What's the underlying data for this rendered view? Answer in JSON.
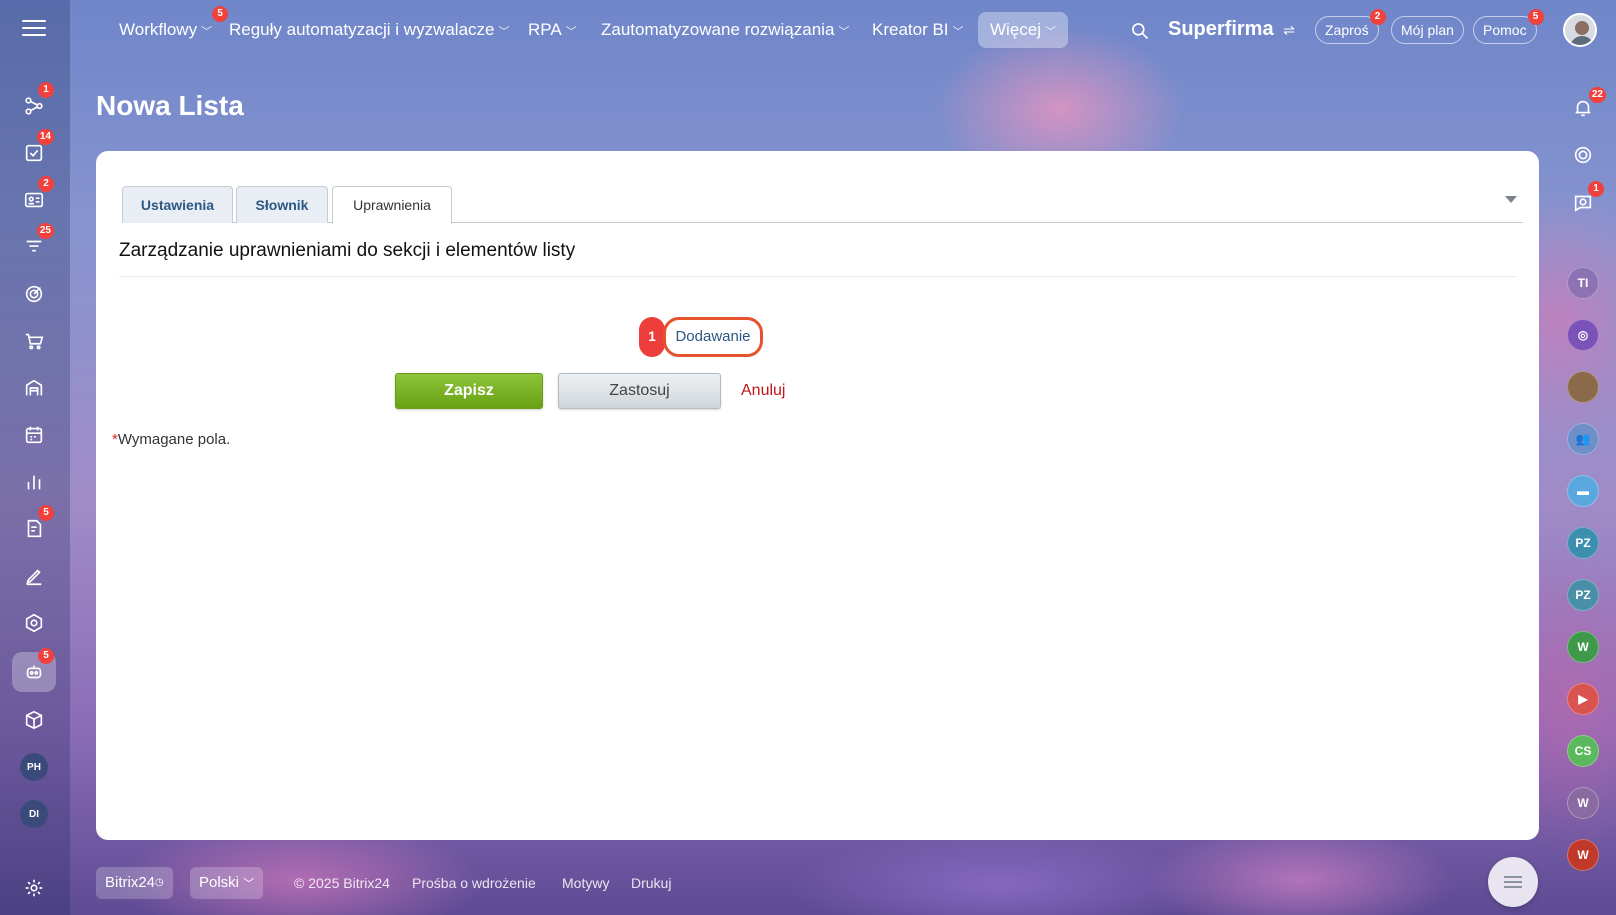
{
  "topnav": {
    "items": [
      {
        "label": "Workflowy",
        "badge": "5"
      },
      {
        "label": "Reguły automatyzacji i wyzwalacze"
      },
      {
        "label": "RPA"
      },
      {
        "label": "Zautomatyzowane rozwiązania"
      },
      {
        "label": "Kreator BI"
      },
      {
        "label": "Więcej"
      }
    ],
    "company": "Superfirma",
    "invite": {
      "label": "Zaproś",
      "badge": "2"
    },
    "my_plan": {
      "label": "Mój plan"
    },
    "help": {
      "label": "Pomoc",
      "badge": "5"
    }
  },
  "page": {
    "title": "Nowa Lista"
  },
  "left_sidebar": {
    "badges": {
      "b1": "1",
      "b2": "14",
      "b3": "2",
      "b4": "25",
      "b5": "5",
      "b6": "5"
    },
    "avatars": {
      "a1": "PH",
      "a2": "DI"
    }
  },
  "right_sidebar": {
    "notifications_badge": "22",
    "chat_badge": "1",
    "avatars": [
      "TI",
      "PZ",
      "PZ",
      "W",
      "CS",
      "W",
      "W"
    ]
  },
  "tabs": [
    {
      "label": "Ustawienia"
    },
    {
      "label": "Słownik"
    },
    {
      "label": "Uprawnienia"
    }
  ],
  "section": {
    "heading": "Zarządzanie uprawnieniami do sekcji i elementów listy"
  },
  "step": {
    "number": "1",
    "link_label": "Dodawanie"
  },
  "actions": {
    "save": "Zapisz",
    "apply": "Zastosuj",
    "cancel": "Anuluj"
  },
  "required_note": {
    "star": "*",
    "text": "Wymagane pola."
  },
  "footer": {
    "brand": "Bitrix24",
    "language": "Polski",
    "copyright": "© 2025 Bitrix24",
    "request": "Prośba o wdrożenie",
    "themes": "Motywy",
    "print": "Drukuj"
  },
  "colors": {
    "save_button": "#7ab42a",
    "cancel_link": "#c0161b",
    "badge": "#f0413d",
    "highlight": "#e5522e"
  }
}
